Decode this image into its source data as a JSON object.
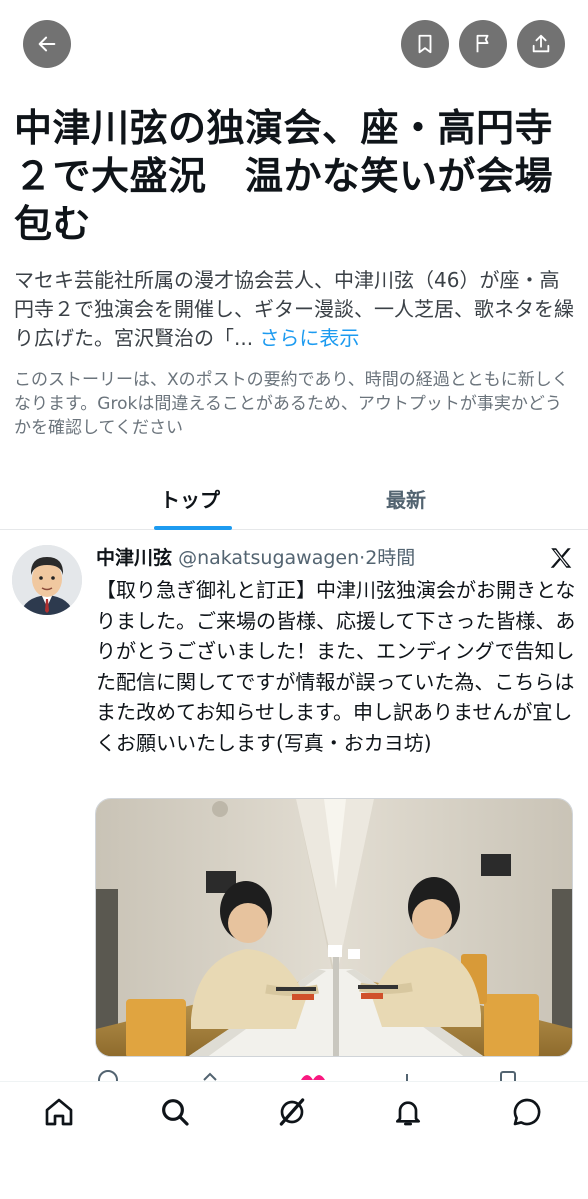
{
  "header": {
    "back_icon": "arrow-left-icon",
    "bookmark_icon": "bookmark-icon",
    "flag_icon": "flag-icon",
    "share_icon": "share-icon",
    "button_color": "#727272"
  },
  "story": {
    "title": "中津川弦の独演会、座・高円寺２で大盛況　温かな笑いが会場包む",
    "summary": "マセキ芸能社所属の漫才協会芸人、中津川弦（46）が座・高円寺２で独演会を開催し、ギター漫談、一人芝居、歌ネタを繰り広げた。宮沢賢治の「...",
    "more_label": "さらに表示",
    "disclaimer": "このストーリーは、Xのポストの要約であり、時間の経過とともに新しくなります。Grokは間違えることがあるため、アウトプットが事実かどうかを確認してください"
  },
  "tabs": [
    {
      "label": "トップ",
      "active": true
    },
    {
      "label": "最新",
      "active": false
    }
  ],
  "post": {
    "author_name": "中津川弦",
    "handle": "@nakatsugawagen",
    "separator": "·",
    "time": "2時間",
    "source_icon": "x-logo-icon",
    "text": "【取り急ぎ御礼と訂正】中津川弦独演会がお開きとなりました。ご来場の皆様、応援して下さった皆様、ありがとうございました！また、エンディングで告知した配信に関してですが情報が誤っていた為、こちらはまた改めてお知らせします。申し訳ありませんが宜しくお願いいたします(写真・おカヨ坊)"
  },
  "bottom_nav": [
    {
      "name": "home",
      "icon": "home-icon"
    },
    {
      "name": "search",
      "icon": "search-icon"
    },
    {
      "name": "grok",
      "icon": "grok-icon"
    },
    {
      "name": "notifications",
      "icon": "bell-icon"
    },
    {
      "name": "messages",
      "icon": "message-icon"
    }
  ],
  "colors": {
    "accent": "#1d9bf0",
    "text": "#0f1419",
    "muted": "#536471",
    "like": "#f91880"
  }
}
